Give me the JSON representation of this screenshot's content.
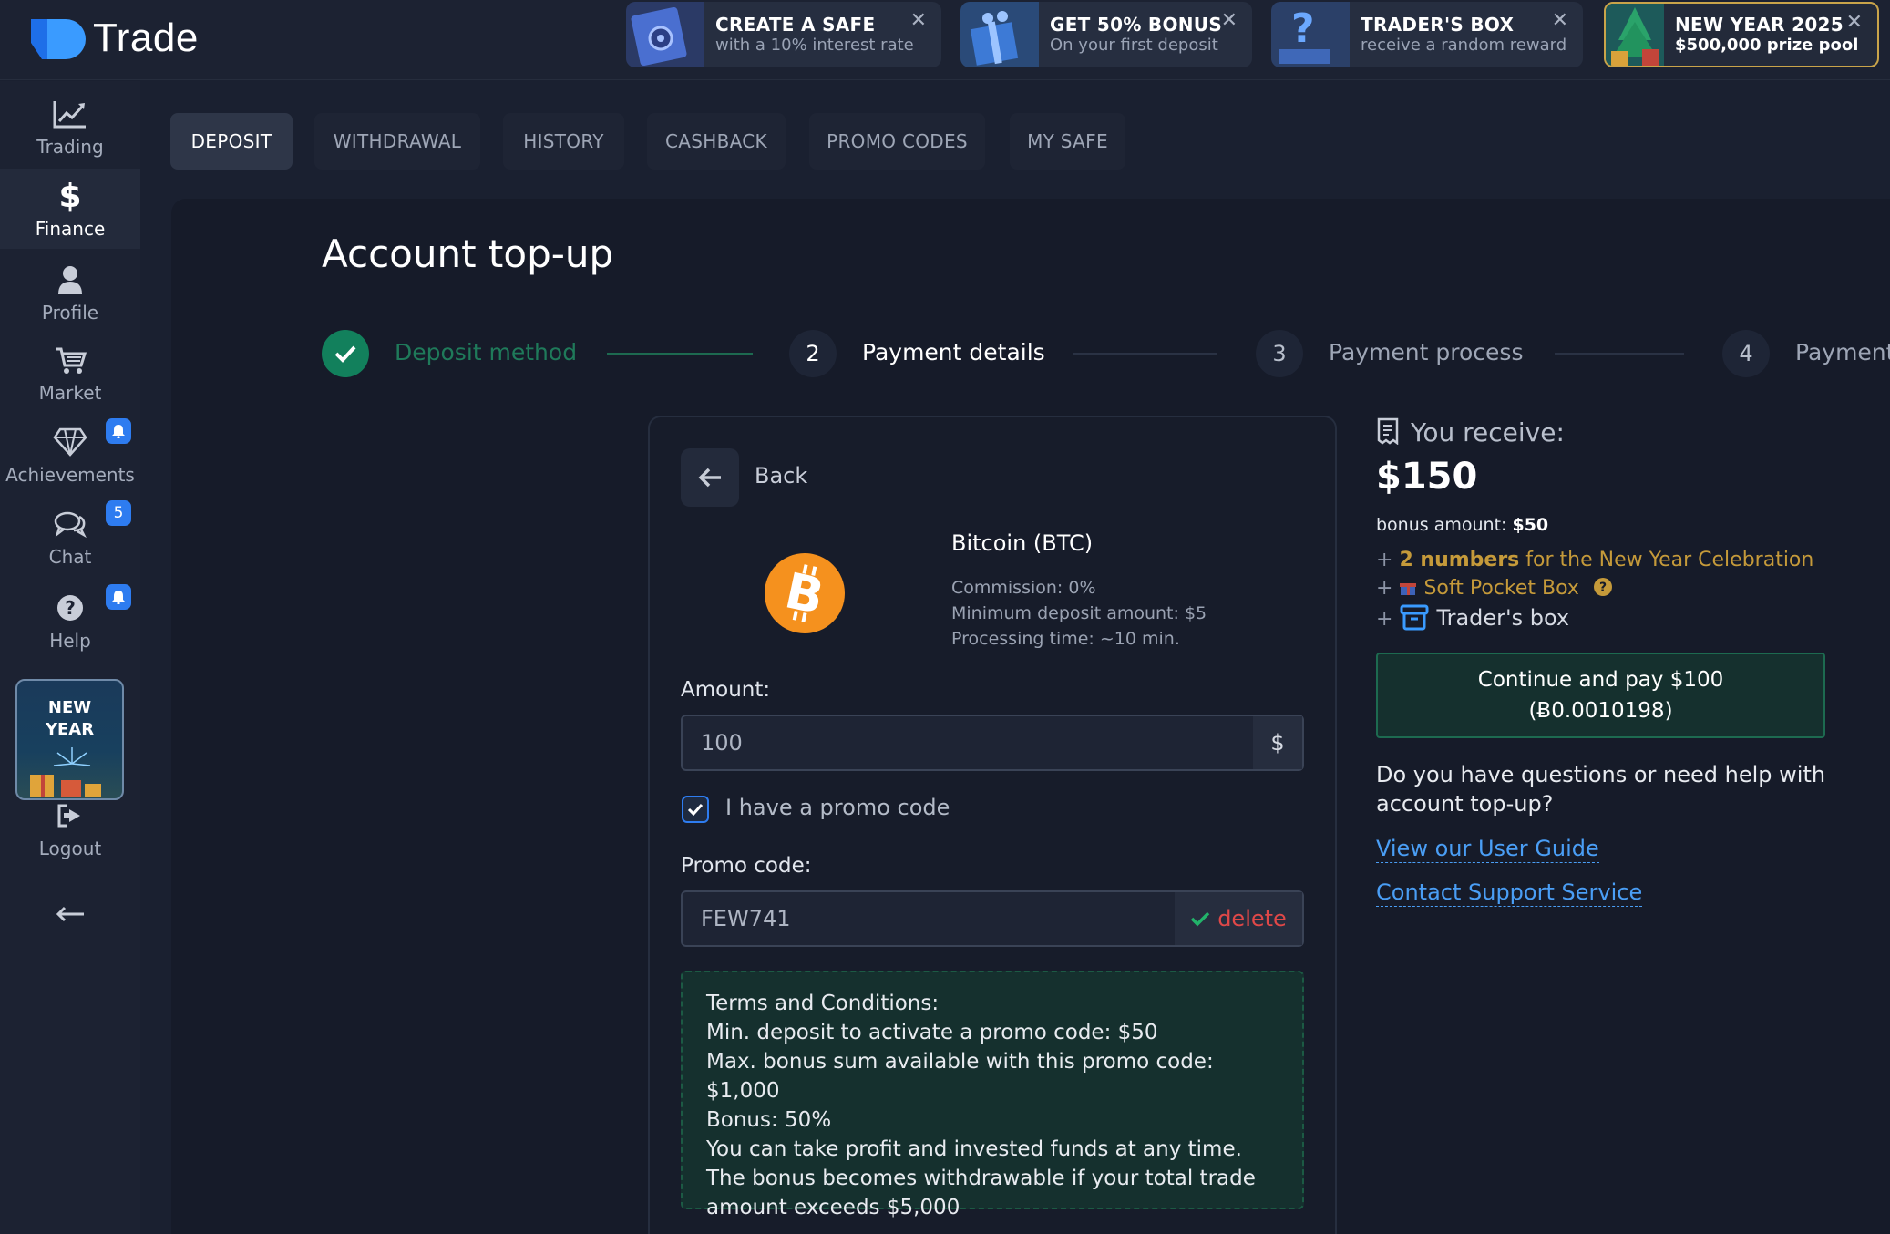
{
  "app": {
    "logo_text": "Trade"
  },
  "promos": [
    {
      "title": "CREATE A SAFE",
      "subtitle": "with a 10% interest rate"
    },
    {
      "title": "GET 50% BONUS",
      "subtitle": "On your first deposit"
    },
    {
      "title": "TRADER'S BOX",
      "subtitle": "receive a random reward"
    },
    {
      "title": "NEW YEAR 2025",
      "subtitle": "$500,000 prize pool"
    }
  ],
  "sidebar": {
    "items": [
      {
        "label": "Trading",
        "icon": "chart-line-icon"
      },
      {
        "label": "Finance",
        "icon": "dollar-icon"
      },
      {
        "label": "Profile",
        "icon": "user-icon"
      },
      {
        "label": "Market",
        "icon": "cart-icon"
      },
      {
        "label": "Achievements",
        "icon": "diamond-icon"
      },
      {
        "label": "Chat",
        "icon": "chat-icon"
      },
      {
        "label": "Help",
        "icon": "question-icon"
      }
    ],
    "chat_badge": "5",
    "new_year_card": [
      "NEW",
      "YEAR"
    ],
    "logout_label": "Logout"
  },
  "tabs": [
    "DEPOSIT",
    "WITHDRAWAL",
    "HISTORY",
    "CASHBACK",
    "PROMO CODES",
    "MY SAFE"
  ],
  "page": {
    "title": "Account top-up"
  },
  "steps": [
    {
      "num": "",
      "label": "Deposit method"
    },
    {
      "num": "2",
      "label": "Payment details"
    },
    {
      "num": "3",
      "label": "Payment process"
    },
    {
      "num": "4",
      "label": "Payment"
    }
  ],
  "payment": {
    "back_label": "Back",
    "coin_name": "Bitcoin (BTC)",
    "commission": "Commission: 0%",
    "min_deposit": "Minimum deposit amount: $5",
    "processing": "Processing time: ~10 min.",
    "amount_label": "Amount:",
    "amount_value": "100",
    "currency_symbol": "$",
    "promo_checkbox_label": "I have a promo code",
    "promo_label": "Promo code:",
    "promo_value": "FEW741",
    "delete_label": "delete",
    "terms": [
      "Terms and Conditions:",
      "Min. deposit to activate a promo code: $50",
      "Max. bonus sum available with this promo code: $1,000",
      "Bonus: 50%",
      "You can take profit and invested funds at any time.",
      "The bonus becomes withdrawable if your total trade",
      "amount exceeds $5,000"
    ]
  },
  "receive": {
    "title": "You receive:",
    "amount": "$150",
    "bonus_label": "bonus amount:",
    "bonus_value": "$50",
    "extra1_strong": "2 numbers",
    "extra1_rest": "for the New Year Celebration",
    "extra2": "Soft Pocket Box",
    "extra3": "Trader's box",
    "continue_line1": "Continue and pay $100",
    "continue_line2": "(Ƀ0.0010198)",
    "help_question": "Do you have questions or need help with account top-up?",
    "link_guide": "View our User Guide",
    "link_support": "Contact Support Service"
  },
  "colors": {
    "accent_blue": "#2e7cf0",
    "success_green": "#12805c",
    "delete_red": "#e04848",
    "bitcoin_orange": "#f5911e",
    "gold": "#c59a3a"
  }
}
